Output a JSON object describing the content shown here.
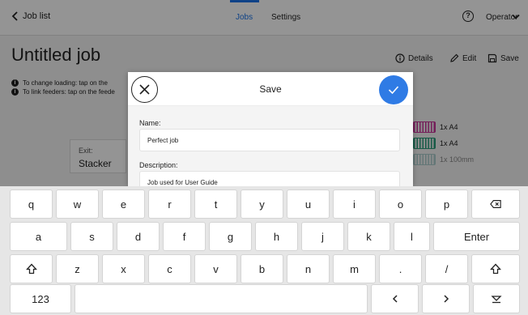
{
  "topbar": {
    "back_label": "Job list",
    "tabs": [
      {
        "label": "Jobs",
        "active": true
      },
      {
        "label": "Settings",
        "active": false
      }
    ],
    "help_icon": "?",
    "operator_label": "Operator"
  },
  "job": {
    "title": "Untitled job",
    "actions": {
      "details": "Details",
      "edit": "Edit",
      "save": "Save"
    },
    "info": [
      "To change loading: tap on the",
      "To link feeders: tap on the feede"
    ],
    "exit_label": "Exit:",
    "exit_value": "Stacker",
    "feeders": [
      {
        "label": "1x A4",
        "color": "#c9359a"
      },
      {
        "label": "1x A4",
        "color": "#2a9d7a"
      },
      {
        "label": "1x 100mm",
        "color": "#66aaaa"
      }
    ]
  },
  "dialog": {
    "title": "Save",
    "name_label": "Name:",
    "name_value": "Perfect job",
    "description_label": "Description:",
    "description_value": "Job used for User Guide"
  },
  "keyboard": {
    "row1": [
      "q",
      "w",
      "e",
      "r",
      "t",
      "y",
      "u",
      "i",
      "o",
      "p"
    ],
    "row2": [
      "a",
      "s",
      "d",
      "f",
      "g",
      "h",
      "j",
      "k",
      "l"
    ],
    "row3": [
      "z",
      "x",
      "c",
      "v",
      "b",
      "n",
      "m",
      ".",
      "/"
    ],
    "enter": "Enter",
    "numbers": "123",
    "colors": {
      "accent": "#2f7be5"
    }
  }
}
